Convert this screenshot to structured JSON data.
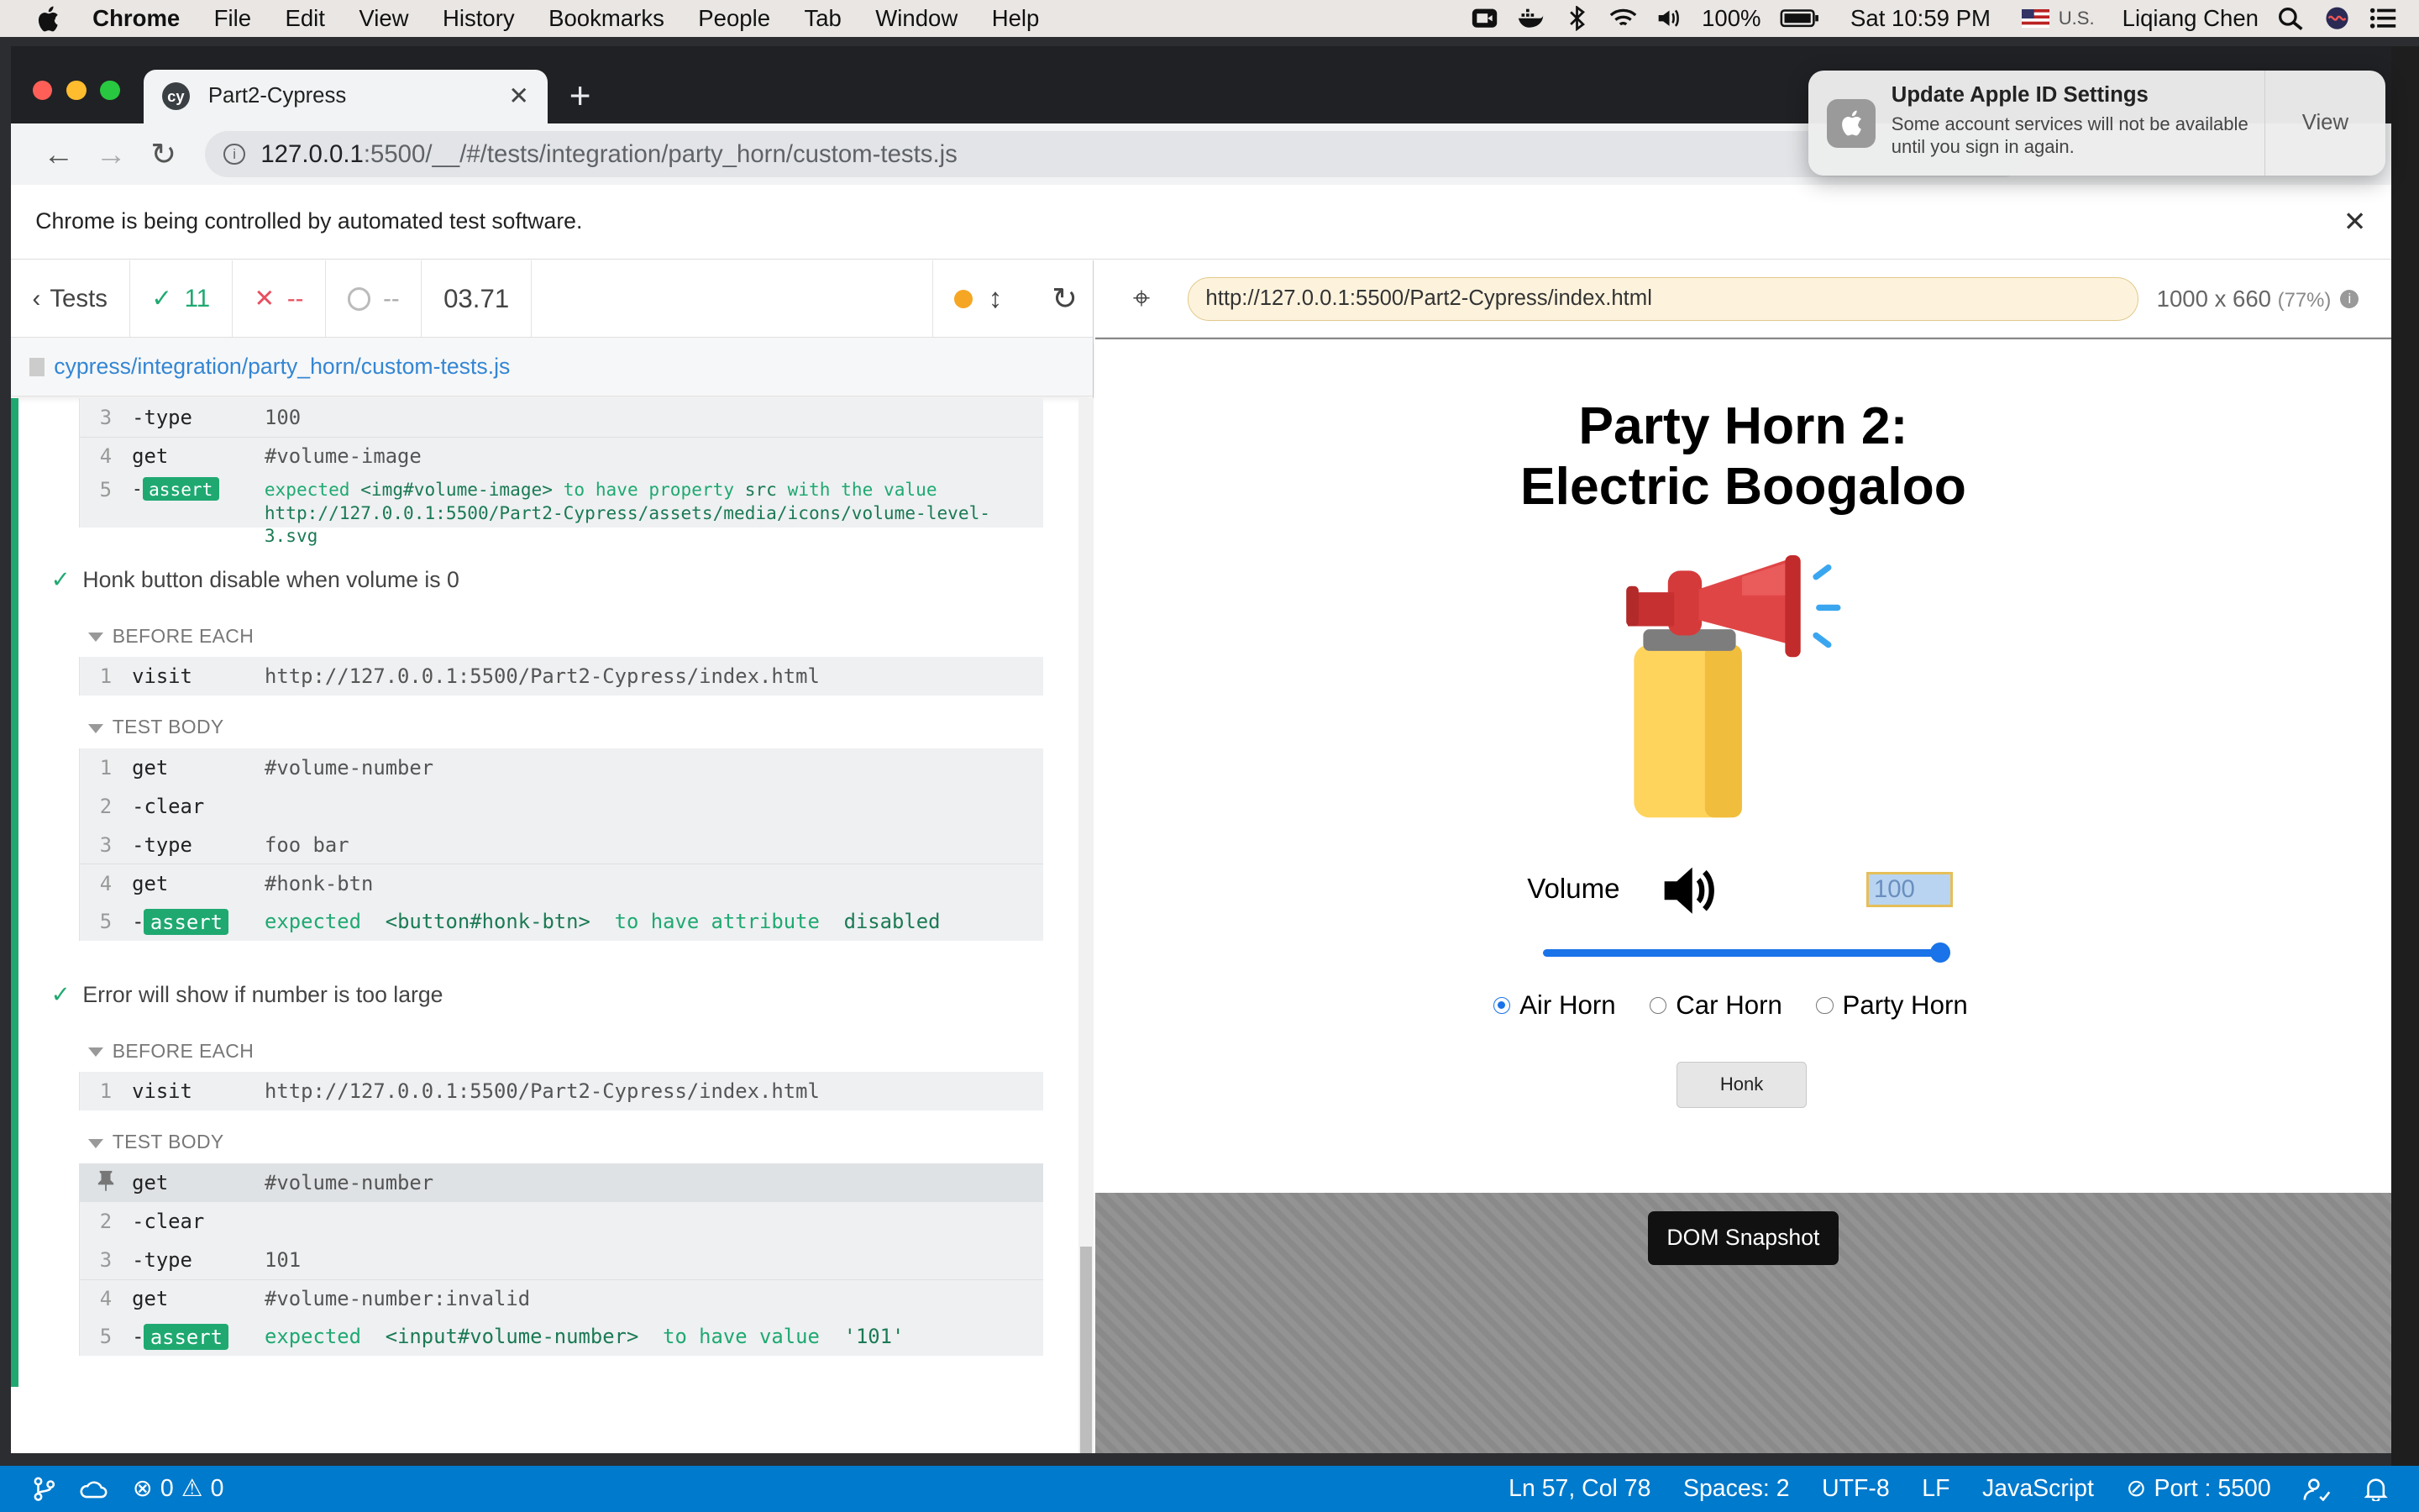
{
  "menubar": {
    "app": "Chrome",
    "items": [
      "File",
      "Edit",
      "View",
      "History",
      "Bookmarks",
      "People",
      "Tab",
      "Window",
      "Help"
    ],
    "battery": "100%",
    "clock": "Sat 10:59 PM",
    "input_source": "U.S.",
    "user": "Liqiang Chen"
  },
  "browser": {
    "tab_title": "Part2-Cypress",
    "tab_favicon": "cy",
    "url_host": "127.0.0.1",
    "url_rest": ":5500/__/#/tests/integration/party_horn/custom-tests.js",
    "infobar_text": "Chrome is being controlled by automated test software."
  },
  "notification": {
    "title": "Update Apple ID Settings",
    "body": "Some account services will not be available until you sign in again.",
    "action": "View"
  },
  "reporter": {
    "back_label": "Tests",
    "passed": "11",
    "failed": "--",
    "pending": "--",
    "duration": "03.71",
    "spec_path": "cypress/integration/party_horn/custom-tests.js",
    "top_group": [
      {
        "num": "3",
        "name": "-type",
        "msg": "100"
      },
      {
        "num": "4",
        "name": "get",
        "msg": "#volume-image"
      }
    ],
    "top_assert": {
      "num": "5",
      "badge": "assert",
      "w1": "expected",
      "w2": "<img#volume-image>",
      "w3": "to have property",
      "w4": "src",
      "w5": "with the value",
      "w6": "http://127.0.0.1:5500/Part2-Cypress/assets/media/icons/volume-level-3.svg"
    },
    "test2": {
      "title": "Honk button disable when volume is 0",
      "before_each_label": "BEFORE EACH",
      "before": {
        "num": "1",
        "name": "visit",
        "msg": "http://127.0.0.1:5500/Part2-Cypress/index.html"
      },
      "body_label": "TEST BODY",
      "cmds": [
        {
          "num": "1",
          "name": "get",
          "msg": "#volume-number"
        },
        {
          "num": "2",
          "name": "-clear",
          "msg": ""
        },
        {
          "num": "3",
          "name": "-type",
          "msg": "foo bar"
        },
        {
          "num": "4",
          "name": "get",
          "msg": "#honk-btn"
        }
      ],
      "assert": {
        "num": "5",
        "badge": "assert",
        "w1": "expected",
        "w2": "<button#honk-btn>",
        "w3": "to have attribute",
        "w4": "disabled"
      }
    },
    "test3": {
      "title": "Error will show if number is too large",
      "before_each_label": "BEFORE EACH",
      "before": {
        "num": "1",
        "name": "visit",
        "msg": "http://127.0.0.1:5500/Part2-Cypress/index.html"
      },
      "body_label": "TEST BODY",
      "cmds": [
        {
          "num": "",
          "name": "get",
          "msg": "#volume-number"
        },
        {
          "num": "2",
          "name": "-clear",
          "msg": ""
        },
        {
          "num": "3",
          "name": "-type",
          "msg": "101"
        },
        {
          "num": "4",
          "name": "get",
          "msg": "#volume-number:invalid"
        }
      ],
      "assert": {
        "num": "5",
        "badge": "assert",
        "w1": "expected",
        "w2": "<input#volume-number>",
        "w3": "to have value",
        "w4": "'101'"
      }
    }
  },
  "aut": {
    "url": "http://127.0.0.1:5500/Part2-Cypress/index.html",
    "viewport": "1000 x 660",
    "scale": "(77%)",
    "snapshot_label": "DOM Snapshot"
  },
  "page": {
    "title_line1": "Party Horn 2:",
    "title_line2": "Electric Boogaloo",
    "volume_label": "Volume",
    "volume_value": "100",
    "volume_level": 1.0,
    "radios": [
      {
        "label": "Air Horn",
        "checked": true
      },
      {
        "label": "Car Horn",
        "checked": false
      },
      {
        "label": "Party Horn",
        "checked": false
      }
    ],
    "honk_label": "Honk"
  },
  "vscode_status": {
    "errors": "0",
    "warnings": "0",
    "position": "Ln 57, Col 78",
    "spaces": "Spaces: 2",
    "encoding": "UTF-8",
    "eol": "LF",
    "language": "JavaScript",
    "port": "Port : 5500"
  }
}
